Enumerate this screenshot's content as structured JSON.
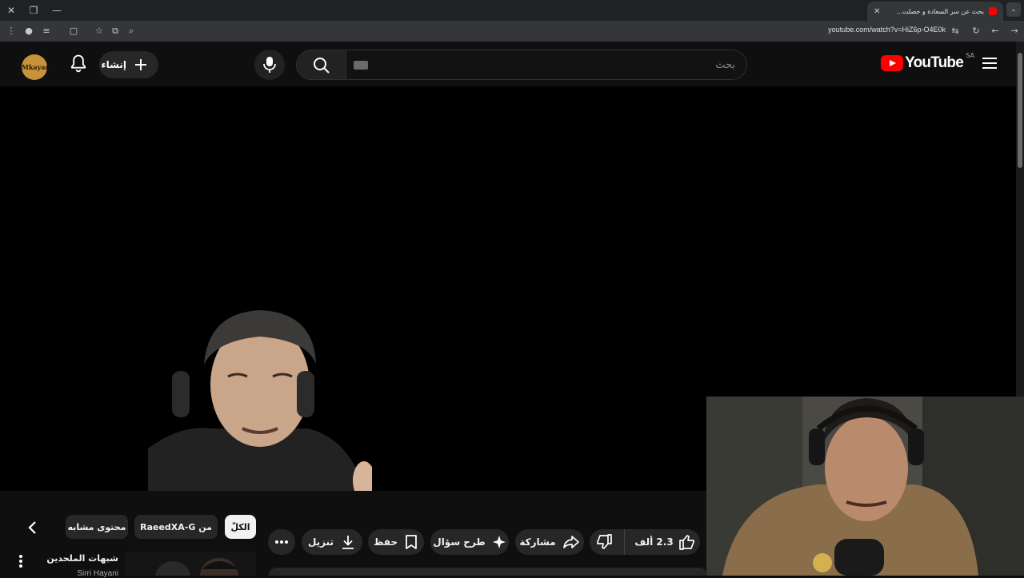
{
  "browser": {
    "tab_title": "بحث عن سر السعادة و حصلت...",
    "url": "youtube.com/watch?v=HiZ6p-O4E0k"
  },
  "masthead": {
    "logo_text": "YouTube",
    "country_code": "SA",
    "search_placeholder": "بحث",
    "create_label": "إنشاء",
    "avatar_text": "Mkayar"
  },
  "filter_chips": [
    {
      "label": "الكلّ",
      "active": true
    },
    {
      "label": "من RaeedXA-G",
      "active": false
    },
    {
      "label": "محتوى مشابه",
      "active": false
    }
  ],
  "actions": {
    "like_count": "2.3 ألف",
    "share_label": "مشاركة",
    "ask_label": "طرح سؤال",
    "save_label": "حفظ",
    "download_label": "تنزيل"
  },
  "recommendation": {
    "title": "شبهات الملحدين",
    "channel": "Sirri Hayani"
  },
  "colors": {
    "background": "#0f0f0f",
    "brand_red": "#ff0000",
    "chip_bg": "#272727",
    "chip_active_bg": "#f1f1f1"
  }
}
